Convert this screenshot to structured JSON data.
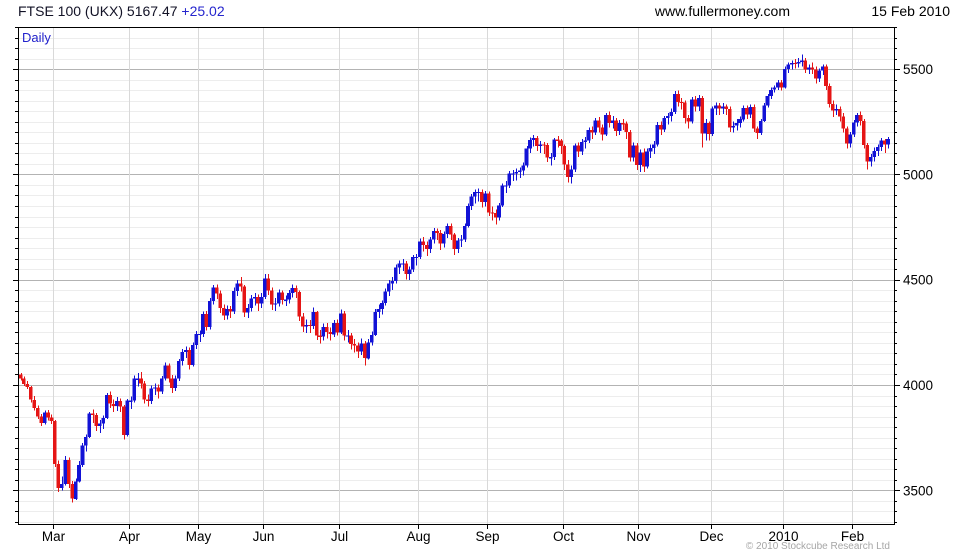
{
  "header": {
    "title": "FTSE 100 (UKX) 5167.47",
    "change": "+25.02",
    "website": "www.fullermoney.com",
    "date": "15 Feb 2010"
  },
  "chart": {
    "frequency_label": "Daily",
    "copyright": "© 2010 Stockcube Research Ltd"
  },
  "colors": {
    "up_candle": "#1212d6",
    "down_candle": "#e51515",
    "change_text": "#2525cd",
    "daily_label": "#2222cc",
    "grid_minor": "#ededed",
    "grid_major": "#b3b3b3",
    "grid_month": "#d9d9d9",
    "axis_line": "#000000",
    "copyright_text": "#a6a6a6"
  },
  "chart_data": {
    "type": "candlestick",
    "title": "FTSE 100 (UKX) Daily",
    "instrument": "FTSE 100 (UKX)",
    "last_price": 5167.47,
    "last_change": 25.02,
    "frequency": "Daily",
    "y_axis": {
      "side": "right",
      "min": 3340,
      "max": 5700,
      "minor_step": 50,
      "major_step": 500,
      "major_labels": [
        5500,
        5000,
        4500,
        4000,
        3500
      ]
    },
    "x_axis": {
      "month_labels": [
        "Mar",
        "Apr",
        "May",
        "Jun",
        "Jul",
        "Aug",
        "Sep",
        "Oct",
        "Nov",
        "Dec",
        "2010",
        "Feb"
      ],
      "month_start_indices": [
        10,
        32,
        52,
        71,
        93,
        116,
        136,
        158,
        180,
        201,
        222,
        242
      ],
      "range": "mid-Feb 2009 to 15 Feb 2010"
    },
    "ohlc": [
      [
        4050,
        4058,
        4022,
        4030
      ],
      [
        4030,
        4041,
        3996,
        4005
      ],
      [
        4005,
        4018,
        3981,
        3990
      ],
      [
        3990,
        3995,
        3918,
        3930
      ],
      [
        3930,
        3947,
        3878,
        3890
      ],
      [
        3890,
        3902,
        3838,
        3850
      ],
      [
        3850,
        3862,
        3805,
        3820
      ],
      [
        3820,
        3879,
        3812,
        3870
      ],
      [
        3870,
        3882,
        3831,
        3845
      ],
      [
        3845,
        3861,
        3814,
        3830
      ],
      [
        3830,
        3834,
        3610,
        3625
      ],
      [
        3625,
        3641,
        3492,
        3512
      ],
      [
        3512,
        3565,
        3498,
        3530
      ],
      [
        3530,
        3662,
        3524,
        3645
      ],
      [
        3645,
        3655,
        3512,
        3530
      ],
      [
        3530,
        3544,
        3442,
        3460
      ],
      [
        3460,
        3555,
        3455,
        3542
      ],
      [
        3542,
        3638,
        3536,
        3620
      ],
      [
        3620,
        3724,
        3611,
        3712
      ],
      [
        3712,
        3765,
        3684,
        3753
      ],
      [
        3753,
        3872,
        3748,
        3864
      ],
      [
        3864,
        3884,
        3820,
        3857
      ],
      [
        3857,
        3868,
        3781,
        3805
      ],
      [
        3805,
        3834,
        3772,
        3817
      ],
      [
        3817,
        3855,
        3792,
        3843
      ],
      [
        3843,
        3961,
        3838,
        3953
      ],
      [
        3953,
        3968,
        3891,
        3911
      ],
      [
        3911,
        3932,
        3872,
        3900
      ],
      [
        3900,
        3942,
        3876,
        3925
      ],
      [
        3925,
        3936,
        3871,
        3898
      ],
      [
        3898,
        3905,
        3742,
        3762
      ],
      [
        3762,
        3934,
        3755,
        3926
      ],
      [
        3926,
        3945,
        3886,
        3926
      ],
      [
        3926,
        4046,
        3916,
        4030
      ],
      [
        4030,
        4058,
        3992,
        4030
      ],
      [
        4030,
        4062,
        3984,
        4007
      ],
      [
        4007,
        4018,
        3912,
        3931
      ],
      [
        3931,
        3955,
        3898,
        3925
      ],
      [
        3925,
        3998,
        3911,
        3984
      ],
      [
        3984,
        4008,
        3952,
        3988
      ],
      [
        3988,
        4002,
        3935,
        3970
      ],
      [
        3970,
        4043,
        3958,
        4031
      ],
      [
        4031,
        4106,
        4022,
        4093
      ],
      [
        4093,
        4101,
        4012,
        4030
      ],
      [
        4030,
        4048,
        3962,
        3987
      ],
      [
        3987,
        4045,
        3971,
        4031
      ],
      [
        4031,
        4124,
        4018,
        4114
      ],
      [
        4114,
        4170,
        4092,
        4156
      ],
      [
        4156,
        4182,
        4128,
        4167
      ],
      [
        4167,
        4178,
        4074,
        4096
      ],
      [
        4096,
        4202,
        4088,
        4189
      ],
      [
        4189,
        4256,
        4172,
        4243
      ],
      [
        4243,
        4258,
        4204,
        4243
      ],
      [
        4243,
        4348,
        4228,
        4336
      ],
      [
        4336,
        4352,
        4258,
        4276
      ],
      [
        4276,
        4412,
        4264,
        4398
      ],
      [
        4398,
        4474,
        4382,
        4462
      ],
      [
        4462,
        4478,
        4408,
        4435
      ],
      [
        4435,
        4448,
        4342,
        4366
      ],
      [
        4366,
        4382,
        4308,
        4331
      ],
      [
        4331,
        4378,
        4312,
        4362
      ],
      [
        4362,
        4376,
        4318,
        4348
      ],
      [
        4348,
        4462,
        4338,
        4446
      ],
      [
        4446,
        4498,
        4422,
        4482
      ],
      [
        4482,
        4512,
        4444,
        4468
      ],
      [
        4468,
        4476,
        4322,
        4345
      ],
      [
        4345,
        4384,
        4318,
        4365
      ],
      [
        4365,
        4428,
        4348,
        4411
      ],
      [
        4411,
        4436,
        4378,
        4417
      ],
      [
        4417,
        4429,
        4352,
        4387
      ],
      [
        4387,
        4436,
        4366,
        4418
      ],
      [
        4418,
        4526,
        4408,
        4506
      ],
      [
        4506,
        4528,
        4428,
        4448
      ],
      [
        4448,
        4462,
        4356,
        4383
      ],
      [
        4383,
        4412,
        4352,
        4387
      ],
      [
        4387,
        4454,
        4372,
        4439
      ],
      [
        4439,
        4448,
        4382,
        4404
      ],
      [
        4404,
        4426,
        4374,
        4405
      ],
      [
        4405,
        4452,
        4388,
        4436
      ],
      [
        4436,
        4478,
        4415,
        4461
      ],
      [
        4461,
        4472,
        4414,
        4442
      ],
      [
        4442,
        4448,
        4304,
        4326
      ],
      [
        4326,
        4342,
        4252,
        4278
      ],
      [
        4278,
        4312,
        4248,
        4286
      ],
      [
        4286,
        4308,
        4246,
        4280
      ],
      [
        4280,
        4368,
        4266,
        4346
      ],
      [
        4346,
        4352,
        4214,
        4234
      ],
      [
        4234,
        4262,
        4198,
        4230
      ],
      [
        4230,
        4292,
        4212,
        4275
      ],
      [
        4275,
        4295,
        4222,
        4252
      ],
      [
        4252,
        4272,
        4212,
        4241
      ],
      [
        4241,
        4308,
        4228,
        4294
      ],
      [
        4294,
        4312,
        4234,
        4249
      ],
      [
        4249,
        4358,
        4242,
        4340
      ],
      [
        4340,
        4352,
        4212,
        4234
      ],
      [
        4234,
        4262,
        4202,
        4236
      ],
      [
        4236,
        4248,
        4168,
        4194
      ],
      [
        4194,
        4218,
        4155,
        4187
      ],
      [
        4187,
        4202,
        4128,
        4158
      ],
      [
        4158,
        4222,
        4142,
        4196
      ],
      [
        4196,
        4208,
        4093,
        4127
      ],
      [
        4127,
        4218,
        4122,
        4202
      ],
      [
        4202,
        4255,
        4188,
        4237
      ],
      [
        4237,
        4362,
        4232,
        4346
      ],
      [
        4346,
        4382,
        4318,
        4361
      ],
      [
        4361,
        4402,
        4334,
        4389
      ],
      [
        4389,
        4458,
        4378,
        4443
      ],
      [
        4443,
        4498,
        4422,
        4481
      ],
      [
        4481,
        4512,
        4452,
        4493
      ],
      [
        4493,
        4572,
        4482,
        4559
      ],
      [
        4559,
        4592,
        4528,
        4577
      ],
      [
        4577,
        4598,
        4542,
        4577
      ],
      [
        4577,
        4588,
        4502,
        4528
      ],
      [
        4528,
        4562,
        4498,
        4548
      ],
      [
        4548,
        4618,
        4536,
        4608
      ],
      [
        4608,
        4622,
        4568,
        4608
      ],
      [
        4608,
        4696,
        4598,
        4682
      ],
      [
        4682,
        4702,
        4635,
        4664
      ],
      [
        4664,
        4682,
        4612,
        4647
      ],
      [
        4647,
        4702,
        4628,
        4690
      ],
      [
        4690,
        4745,
        4672,
        4732
      ],
      [
        4732,
        4742,
        4688,
        4722
      ],
      [
        4722,
        4735,
        4642,
        4672
      ],
      [
        4672,
        4728,
        4652,
        4716
      ],
      [
        4716,
        4768,
        4698,
        4755
      ],
      [
        4755,
        4766,
        4688,
        4714
      ],
      [
        4714,
        4722,
        4618,
        4645
      ],
      [
        4645,
        4698,
        4628,
        4686
      ],
      [
        4686,
        4712,
        4655,
        4692
      ],
      [
        4692,
        4768,
        4678,
        4756
      ],
      [
        4756,
        4862,
        4748,
        4851
      ],
      [
        4851,
        4908,
        4832,
        4896
      ],
      [
        4896,
        4928,
        4862,
        4916
      ],
      [
        4916,
        4932,
        4872,
        4917
      ],
      [
        4917,
        4928,
        4842,
        4869
      ],
      [
        4869,
        4922,
        4848,
        4909
      ],
      [
        4909,
        4918,
        4802,
        4820
      ],
      [
        4820,
        4848,
        4782,
        4817
      ],
      [
        4817,
        4834,
        4762,
        4796
      ],
      [
        4796,
        4865,
        4782,
        4852
      ],
      [
        4852,
        4958,
        4845,
        4947
      ],
      [
        4947,
        4968,
        4912,
        4948
      ],
      [
        4948,
        5016,
        4936,
        5004
      ],
      [
        5004,
        5022,
        4968,
        5005
      ],
      [
        5005,
        5028,
        4972,
        5011
      ],
      [
        5011,
        5032,
        4982,
        5018
      ],
      [
        5018,
        5056,
        4995,
        5042
      ],
      [
        5042,
        5136,
        5032,
        5124
      ],
      [
        5124,
        5176,
        5102,
        5164
      ],
      [
        5164,
        5186,
        5132,
        5173
      ],
      [
        5173,
        5182,
        5112,
        5134
      ],
      [
        5134,
        5158,
        5102,
        5142
      ],
      [
        5142,
        5155,
        5098,
        5139
      ],
      [
        5139,
        5148,
        5058,
        5079
      ],
      [
        5079,
        5102,
        5042,
        5082
      ],
      [
        5082,
        5172,
        5068,
        5165
      ],
      [
        5165,
        5182,
        5128,
        5160
      ],
      [
        5160,
        5168,
        5098,
        5134
      ],
      [
        5134,
        5142,
        5022,
        5048
      ],
      [
        5048,
        5068,
        4962,
        4988
      ],
      [
        4988,
        5042,
        4958,
        5024
      ],
      [
        5024,
        5146,
        5012,
        5138
      ],
      [
        5138,
        5152,
        5082,
        5108
      ],
      [
        5108,
        5168,
        5092,
        5154
      ],
      [
        5154,
        5178,
        5122,
        5161
      ],
      [
        5161,
        5222,
        5148,
        5210
      ],
      [
        5210,
        5228,
        5168,
        5200
      ],
      [
        5200,
        5268,
        5188,
        5256
      ],
      [
        5256,
        5272,
        5198,
        5223
      ],
      [
        5223,
        5238,
        5162,
        5190
      ],
      [
        5190,
        5292,
        5182,
        5281
      ],
      [
        5281,
        5298,
        5222,
        5243
      ],
      [
        5243,
        5278,
        5218,
        5257
      ],
      [
        5257,
        5268,
        5182,
        5207
      ],
      [
        5207,
        5258,
        5188,
        5243
      ],
      [
        5243,
        5262,
        5212,
        5242
      ],
      [
        5242,
        5252,
        5168,
        5201
      ],
      [
        5201,
        5212,
        5062,
        5081
      ],
      [
        5081,
        5152,
        5062,
        5138
      ],
      [
        5138,
        5148,
        5022,
        5044
      ],
      [
        5044,
        5118,
        5012,
        5104
      ],
      [
        5104,
        5122,
        5012,
        5038
      ],
      [
        5038,
        5122,
        5028,
        5108
      ],
      [
        5108,
        5142,
        5078,
        5125
      ],
      [
        5125,
        5158,
        5098,
        5142
      ],
      [
        5142,
        5248,
        5132,
        5235
      ],
      [
        5235,
        5252,
        5188,
        5213
      ],
      [
        5213,
        5278,
        5202,
        5267
      ],
      [
        5267,
        5292,
        5238,
        5278
      ],
      [
        5278,
        5312,
        5252,
        5296
      ],
      [
        5296,
        5396,
        5288,
        5382
      ],
      [
        5382,
        5398,
        5322,
        5345
      ],
      [
        5345,
        5362,
        5308,
        5342
      ],
      [
        5342,
        5352,
        5242,
        5267
      ],
      [
        5267,
        5282,
        5218,
        5251
      ],
      [
        5251,
        5368,
        5242,
        5355
      ],
      [
        5355,
        5372,
        5298,
        5323
      ],
      [
        5323,
        5378,
        5302,
        5364
      ],
      [
        5364,
        5372,
        5128,
        5194
      ],
      [
        5194,
        5262,
        5162,
        5245
      ],
      [
        5245,
        5252,
        5162,
        5191
      ],
      [
        5191,
        5322,
        5182,
        5313
      ],
      [
        5313,
        5342,
        5282,
        5327
      ],
      [
        5327,
        5338,
        5282,
        5313
      ],
      [
        5313,
        5338,
        5288,
        5322
      ],
      [
        5322,
        5332,
        5282,
        5311
      ],
      [
        5311,
        5322,
        5202,
        5223
      ],
      [
        5223,
        5252,
        5198,
        5231
      ],
      [
        5231,
        5262,
        5208,
        5244
      ],
      [
        5244,
        5275,
        5222,
        5262
      ],
      [
        5262,
        5328,
        5252,
        5315
      ],
      [
        5315,
        5328,
        5262,
        5285
      ],
      [
        5285,
        5332,
        5268,
        5320
      ],
      [
        5320,
        5332,
        5202,
        5218
      ],
      [
        5218,
        5228,
        5168,
        5197
      ],
      [
        5197,
        5262,
        5188,
        5253
      ],
      [
        5253,
        5338,
        5248,
        5328
      ],
      [
        5328,
        5382,
        5318,
        5372
      ],
      [
        5372,
        5412,
        5358,
        5402
      ],
      [
        5402,
        5422,
        5388,
        5413
      ],
      [
        5413,
        5448,
        5402,
        5437
      ],
      [
        5437,
        5448,
        5398,
        5413
      ],
      [
        5413,
        5512,
        5408,
        5500
      ],
      [
        5500,
        5532,
        5482,
        5522
      ],
      [
        5522,
        5542,
        5498,
        5530
      ],
      [
        5530,
        5548,
        5502,
        5527
      ],
      [
        5527,
        5552,
        5508,
        5534
      ],
      [
        5534,
        5569,
        5512,
        5540
      ],
      [
        5540,
        5552,
        5482,
        5498
      ],
      [
        5498,
        5522,
        5478,
        5507
      ],
      [
        5507,
        5532,
        5478,
        5498
      ],
      [
        5498,
        5512,
        5432,
        5455
      ],
      [
        5455,
        5502,
        5438,
        5494
      ],
      [
        5494,
        5522,
        5472,
        5513
      ],
      [
        5513,
        5522,
        5402,
        5420
      ],
      [
        5420,
        5432,
        5318,
        5335
      ],
      [
        5335,
        5352,
        5272,
        5303
      ],
      [
        5303,
        5332,
        5282,
        5311
      ],
      [
        5311,
        5322,
        5252,
        5276
      ],
      [
        5276,
        5292,
        5198,
        5217
      ],
      [
        5217,
        5228,
        5122,
        5146
      ],
      [
        5146,
        5202,
        5128,
        5189
      ],
      [
        5189,
        5258,
        5178,
        5247
      ],
      [
        5247,
        5292,
        5228,
        5283
      ],
      [
        5283,
        5298,
        5232,
        5253
      ],
      [
        5253,
        5262,
        5122,
        5139
      ],
      [
        5139,
        5148,
        5023,
        5060
      ],
      [
        5060,
        5098,
        5038,
        5082
      ],
      [
        5082,
        5128,
        5062,
        5111
      ],
      [
        5111,
        5142,
        5088,
        5131
      ],
      [
        5131,
        5172,
        5112,
        5161
      ],
      [
        5161,
        5168,
        5102,
        5142
      ],
      [
        5142,
        5178,
        5122,
        5167
      ]
    ]
  }
}
